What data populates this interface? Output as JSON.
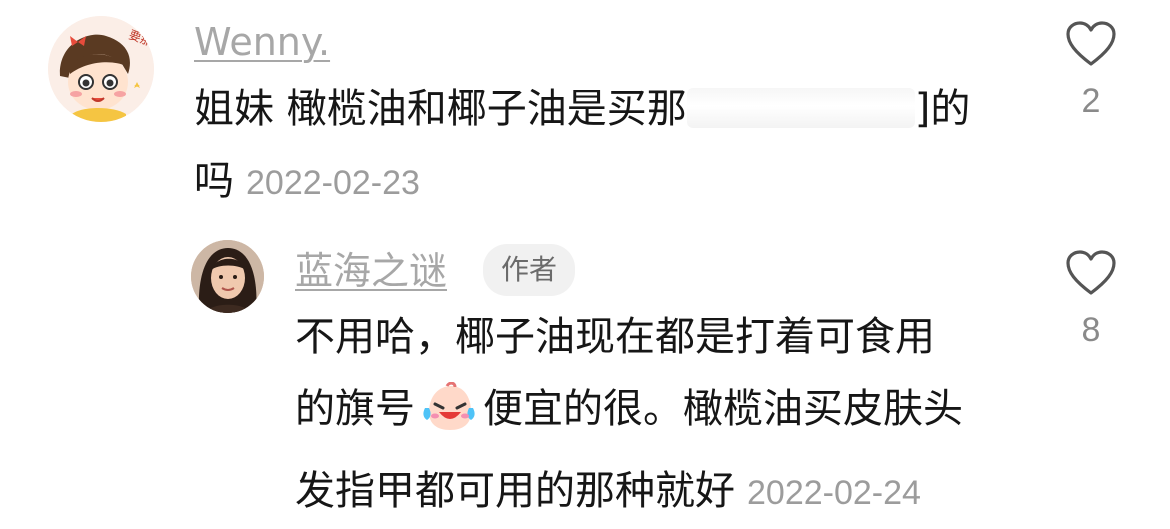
{
  "comments": [
    {
      "username": "Wenny.",
      "avatar": "cartoon-girl-avatar",
      "avatar_stamp": "要那个",
      "text_before": "姐妹 橄榄油和椰子油是买那",
      "redacted": true,
      "text_after_redaction": "]的",
      "text_line2": "吗",
      "timestamp": "2022-02-23",
      "like_icon": "heart-outline-icon",
      "like_count": "2"
    },
    {
      "username": "蓝海之谜",
      "avatar": "woman-photo-avatar",
      "badge": "作者",
      "text_line1": "不用哈，椰子油现在都是打着可食用",
      "text_line2_a": "的旗号",
      "emoji": "crying-laughing-emoji",
      "text_line2_b": "便宜的很。橄榄油买皮肤头",
      "text_line3": "发指甲都可用的那种就好",
      "timestamp": "2022-02-24",
      "like_icon": "heart-outline-icon",
      "like_count": "8"
    }
  ],
  "colors": {
    "username": "#a7a7a7",
    "text": "#161616",
    "timestamp": "#9c9c9c",
    "badge_bg": "#f1f1f1"
  }
}
